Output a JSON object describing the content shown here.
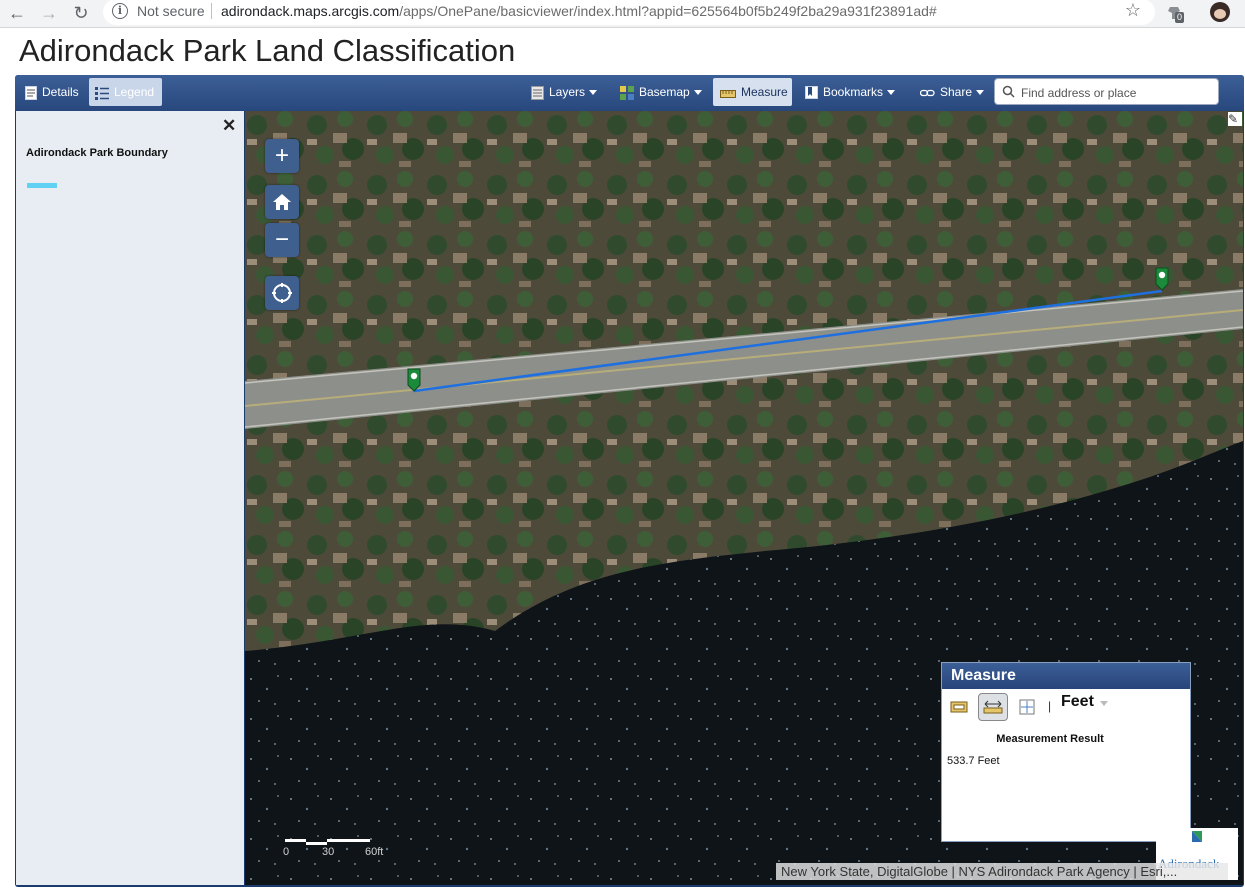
{
  "browser": {
    "not_secure_label": "Not secure",
    "url_host": "adirondack.maps.arcgis.com",
    "url_path": "/apps/OnePane/basicviewer/index.html?appid=625564b0f5b249f2ba29a931f23891ad#",
    "extension_badge": "0"
  },
  "app": {
    "title": "Adirondack Park Land Classification"
  },
  "toolbar": {
    "details": "Details",
    "legend": "Legend",
    "layers": "Layers",
    "basemap": "Basemap",
    "measure": "Measure",
    "bookmarks": "Bookmarks",
    "share": "Share",
    "search_placeholder": "Find address or place"
  },
  "legend_panel": {
    "close": "✕",
    "layer_name": "Adirondack Park Boundary",
    "swatch_color": "#5fd1f2"
  },
  "map_controls": {
    "zoom_in": "+",
    "zoom_out": "−"
  },
  "measure_widget": {
    "title": "Measure",
    "unit": "Feet",
    "result_title": "Measurement Result",
    "result_value": "533.7 Feet"
  },
  "scalebar": {
    "labels": [
      "0",
      "30",
      "60ft"
    ]
  },
  "attribution": "New York State, DigitalGlobe | NYS Adirondack Park Agency | Esri,...",
  "logo_text": "Adirondack",
  "colors": {
    "toolbar": "#2f5288",
    "measure_line": "#1e6fe0",
    "marker": "#1b8a3a"
  }
}
